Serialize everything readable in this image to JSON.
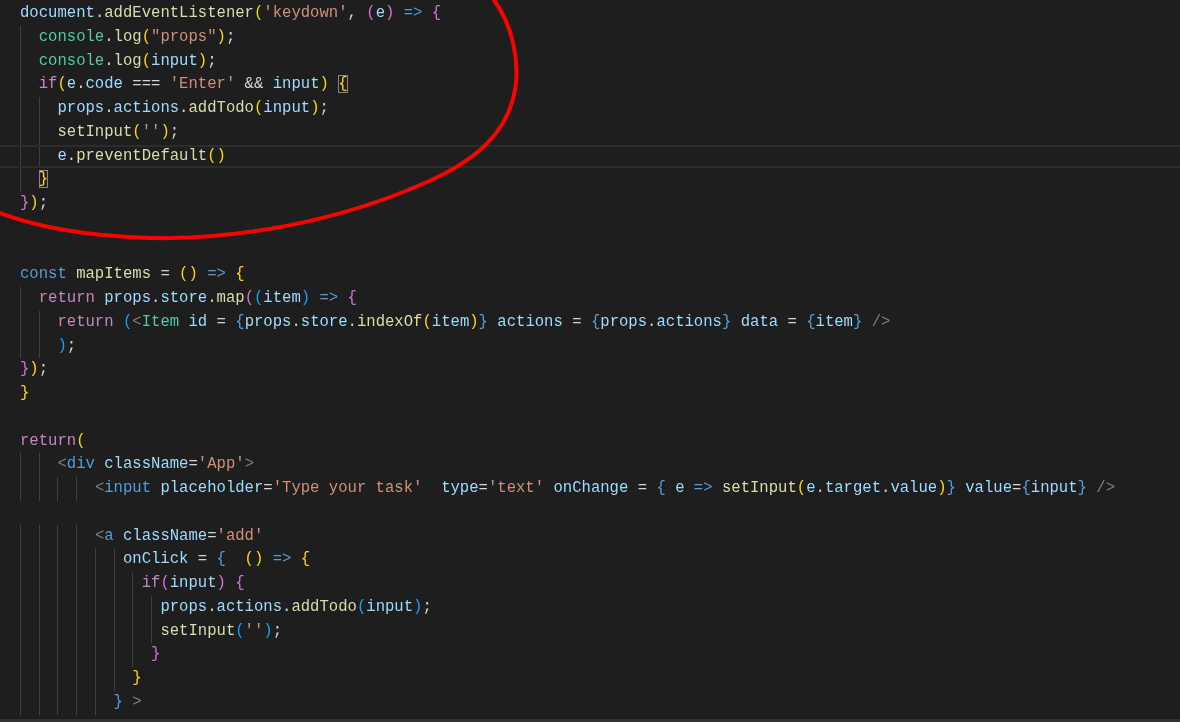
{
  "editor": {
    "lines": [
      {
        "current": false,
        "tokens": [
          {
            "text": "document",
            "kind": "var"
          },
          {
            "text": ".",
            "kind": "punct"
          },
          {
            "text": "addEventListener",
            "kind": "func"
          },
          {
            "text": "(",
            "kind": "bracket1"
          },
          {
            "text": "'keydown'",
            "kind": "string"
          },
          {
            "text": ", ",
            "kind": "punct"
          },
          {
            "text": "(",
            "kind": "bracket2"
          },
          {
            "text": "e",
            "kind": "var"
          },
          {
            "text": ")",
            "kind": "bracket2"
          },
          {
            "text": " => ",
            "kind": "storage"
          },
          {
            "text": "{",
            "kind": "bracket2"
          }
        ]
      },
      {
        "current": false,
        "tokens": [
          {
            "text": "  console",
            "kind": "type"
          },
          {
            "text": ".",
            "kind": "punct"
          },
          {
            "text": "log",
            "kind": "func"
          },
          {
            "text": "(",
            "kind": "bracket1"
          },
          {
            "text": "\"props\"",
            "kind": "string"
          },
          {
            "text": ")",
            "kind": "bracket1"
          },
          {
            "text": ";",
            "kind": "punct"
          }
        ]
      },
      {
        "current": false,
        "tokens": [
          {
            "text": "  console",
            "kind": "type"
          },
          {
            "text": ".",
            "kind": "punct"
          },
          {
            "text": "log",
            "kind": "func"
          },
          {
            "text": "(",
            "kind": "bracket1"
          },
          {
            "text": "input",
            "kind": "var"
          },
          {
            "text": ")",
            "kind": "bracket1"
          },
          {
            "text": ";",
            "kind": "punct"
          }
        ]
      },
      {
        "current": false,
        "tokens": [
          {
            "text": "  if",
            "kind": "keyword"
          },
          {
            "text": "(",
            "kind": "bracket1"
          },
          {
            "text": "e",
            "kind": "var"
          },
          {
            "text": ".",
            "kind": "punct"
          },
          {
            "text": "code",
            "kind": "var"
          },
          {
            "text": " === ",
            "kind": "punct"
          },
          {
            "text": "'Enter'",
            "kind": "string"
          },
          {
            "text": " && ",
            "kind": "punct"
          },
          {
            "text": "input",
            "kind": "var"
          },
          {
            "text": ") ",
            "kind": "bracket1"
          },
          {
            "text": "{",
            "kind": "matched"
          }
        ]
      },
      {
        "current": false,
        "tokens": [
          {
            "text": "    props",
            "kind": "var"
          },
          {
            "text": ".",
            "kind": "punct"
          },
          {
            "text": "actions",
            "kind": "var"
          },
          {
            "text": ".",
            "kind": "punct"
          },
          {
            "text": "addTodo",
            "kind": "func"
          },
          {
            "text": "(",
            "kind": "bracket1"
          },
          {
            "text": "input",
            "kind": "var"
          },
          {
            "text": ")",
            "kind": "bracket1"
          },
          {
            "text": ";",
            "kind": "punct"
          }
        ]
      },
      {
        "current": false,
        "tokens": [
          {
            "text": "    setInput",
            "kind": "func"
          },
          {
            "text": "(",
            "kind": "bracket1"
          },
          {
            "text": "''",
            "kind": "string"
          },
          {
            "text": ")",
            "kind": "bracket1"
          },
          {
            "text": ";",
            "kind": "punct"
          }
        ]
      },
      {
        "current": true,
        "tokens": [
          {
            "text": "    e",
            "kind": "var"
          },
          {
            "text": ".",
            "kind": "punct"
          },
          {
            "text": "preventDefault",
            "kind": "func"
          },
          {
            "text": "()",
            "kind": "bracket1"
          }
        ]
      },
      {
        "current": false,
        "tokens": [
          {
            "text": "  }",
            "kind": "matched"
          }
        ]
      },
      {
        "current": false,
        "tokens": [
          {
            "text": "}",
            "kind": "bracket2"
          },
          {
            "text": ")",
            "kind": "bracket1"
          },
          {
            "text": ";",
            "kind": "punct"
          }
        ]
      },
      {
        "current": false
      },
      {
        "current": false
      },
      {
        "current": false,
        "tokens": [
          {
            "text": "const ",
            "kind": "storage"
          },
          {
            "text": "mapItems",
            "kind": "func"
          },
          {
            "text": " = ",
            "kind": "punct"
          },
          {
            "text": "() ",
            "kind": "bracket1"
          },
          {
            "text": "=> ",
            "kind": "storage"
          },
          {
            "text": "{",
            "kind": "bracket1"
          }
        ]
      },
      {
        "current": false,
        "tokens": [
          {
            "text": "  return ",
            "kind": "keyword"
          },
          {
            "text": "props",
            "kind": "var"
          },
          {
            "text": ".",
            "kind": "punct"
          },
          {
            "text": "store",
            "kind": "var"
          },
          {
            "text": ".",
            "kind": "punct"
          },
          {
            "text": "map",
            "kind": "func"
          },
          {
            "text": "(",
            "kind": "bracket2"
          },
          {
            "text": "(",
            "kind": "bracket3"
          },
          {
            "text": "item",
            "kind": "var"
          },
          {
            "text": ") ",
            "kind": "bracket3"
          },
          {
            "text": "=> ",
            "kind": "storage"
          },
          {
            "text": "{",
            "kind": "bracket2"
          }
        ]
      },
      {
        "current": false,
        "tokens": [
          {
            "text": "    return ",
            "kind": "keyword"
          },
          {
            "text": "(",
            "kind": "bracket3"
          },
          {
            "text": "<",
            "kind": "tag"
          },
          {
            "text": "Item ",
            "kind": "type"
          },
          {
            "text": "id",
            "kind": "attr"
          },
          {
            "text": " = ",
            "kind": "punct"
          },
          {
            "text": "{",
            "kind": "storage"
          },
          {
            "text": "props",
            "kind": "var"
          },
          {
            "text": ".",
            "kind": "punct"
          },
          {
            "text": "store",
            "kind": "var"
          },
          {
            "text": ".",
            "kind": "punct"
          },
          {
            "text": "indexOf",
            "kind": "func"
          },
          {
            "text": "(",
            "kind": "bracket1"
          },
          {
            "text": "item",
            "kind": "var"
          },
          {
            "text": ")",
            "kind": "bracket1"
          },
          {
            "text": "} ",
            "kind": "storage"
          },
          {
            "text": "actions",
            "kind": "attr"
          },
          {
            "text": " = ",
            "kind": "punct"
          },
          {
            "text": "{",
            "kind": "storage"
          },
          {
            "text": "props",
            "kind": "var"
          },
          {
            "text": ".",
            "kind": "punct"
          },
          {
            "text": "actions",
            "kind": "var"
          },
          {
            "text": "} ",
            "kind": "storage"
          },
          {
            "text": "data",
            "kind": "attr"
          },
          {
            "text": " = ",
            "kind": "punct"
          },
          {
            "text": "{",
            "kind": "storage"
          },
          {
            "text": "item",
            "kind": "var"
          },
          {
            "text": "} ",
            "kind": "storage"
          },
          {
            "text": "/>",
            "kind": "tag"
          }
        ]
      },
      {
        "current": false,
        "tokens": [
          {
            "text": "    )",
            "kind": "bracket3"
          },
          {
            "text": ";",
            "kind": "punct"
          }
        ]
      },
      {
        "current": false,
        "tokens": [
          {
            "text": "}",
            "kind": "bracket2"
          },
          {
            "text": ")",
            "kind": "bracket1"
          },
          {
            "text": ";",
            "kind": "punct"
          }
        ]
      },
      {
        "current": false,
        "tokens": [
          {
            "text": "}",
            "kind": "bracket1"
          }
        ]
      },
      {
        "current": false
      },
      {
        "current": false,
        "tokens": [
          {
            "text": "return",
            "kind": "keyword"
          },
          {
            "text": "(",
            "kind": "bracket1"
          }
        ]
      },
      {
        "current": false,
        "tokens": [
          {
            "text": "    <",
            "kind": "tag"
          },
          {
            "text": "div ",
            "kind": "storage"
          },
          {
            "text": "className",
            "kind": "attr"
          },
          {
            "text": "=",
            "kind": "punct"
          },
          {
            "text": "'App'",
            "kind": "string"
          },
          {
            "text": ">",
            "kind": "tag"
          }
        ]
      },
      {
        "current": false,
        "tokens": [
          {
            "text": "        <",
            "kind": "tag"
          },
          {
            "text": "input ",
            "kind": "storage"
          },
          {
            "text": "placeholder",
            "kind": "attr"
          },
          {
            "text": "=",
            "kind": "punct"
          },
          {
            "text": "'Type your task'  ",
            "kind": "string"
          },
          {
            "text": "type",
            "kind": "attr"
          },
          {
            "text": "=",
            "kind": "punct"
          },
          {
            "text": "'text' ",
            "kind": "string"
          },
          {
            "text": "onChange",
            "kind": "attr"
          },
          {
            "text": " = ",
            "kind": "punct"
          },
          {
            "text": "{ ",
            "kind": "storage"
          },
          {
            "text": "e ",
            "kind": "var"
          },
          {
            "text": "=> ",
            "kind": "storage"
          },
          {
            "text": "setInput",
            "kind": "func"
          },
          {
            "text": "(",
            "kind": "bracket1"
          },
          {
            "text": "e",
            "kind": "var"
          },
          {
            "text": ".",
            "kind": "punct"
          },
          {
            "text": "target",
            "kind": "var"
          },
          {
            "text": ".",
            "kind": "punct"
          },
          {
            "text": "value",
            "kind": "var"
          },
          {
            "text": ")",
            "kind": "bracket1"
          },
          {
            "text": "} ",
            "kind": "storage"
          },
          {
            "text": "value",
            "kind": "attr"
          },
          {
            "text": "=",
            "kind": "punct"
          },
          {
            "text": "{",
            "kind": "storage"
          },
          {
            "text": "input",
            "kind": "var"
          },
          {
            "text": "} ",
            "kind": "storage"
          },
          {
            "text": "/>",
            "kind": "tag"
          }
        ]
      },
      {
        "current": false
      },
      {
        "current": false,
        "tokens": [
          {
            "text": "        <",
            "kind": "tag"
          },
          {
            "text": "a ",
            "kind": "storage"
          },
          {
            "text": "className",
            "kind": "attr"
          },
          {
            "text": "=",
            "kind": "punct"
          },
          {
            "text": "'add'",
            "kind": "string"
          }
        ]
      },
      {
        "current": false,
        "tokens": [
          {
            "text": "           onClick",
            "kind": "attr"
          },
          {
            "text": " = ",
            "kind": "punct"
          },
          {
            "text": "{  ",
            "kind": "storage"
          },
          {
            "text": "() ",
            "kind": "bracket1"
          },
          {
            "text": "=> ",
            "kind": "storage"
          },
          {
            "text": "{",
            "kind": "bracket1"
          }
        ]
      },
      {
        "current": false,
        "tokens": [
          {
            "text": "             if",
            "kind": "keyword"
          },
          {
            "text": "(",
            "kind": "bracket2"
          },
          {
            "text": "input",
            "kind": "var"
          },
          {
            "text": ") ",
            "kind": "bracket2"
          },
          {
            "text": "{",
            "kind": "bracket2"
          }
        ]
      },
      {
        "current": false,
        "tokens": [
          {
            "text": "               props",
            "kind": "var"
          },
          {
            "text": ".",
            "kind": "punct"
          },
          {
            "text": "actions",
            "kind": "var"
          },
          {
            "text": ".",
            "kind": "punct"
          },
          {
            "text": "addTodo",
            "kind": "func"
          },
          {
            "text": "(",
            "kind": "bracket3"
          },
          {
            "text": "input",
            "kind": "var"
          },
          {
            "text": ")",
            "kind": "bracket3"
          },
          {
            "text": ";",
            "kind": "punct"
          }
        ]
      },
      {
        "current": false,
        "tokens": [
          {
            "text": "               setInput",
            "kind": "func"
          },
          {
            "text": "(",
            "kind": "bracket3"
          },
          {
            "text": "''",
            "kind": "string"
          },
          {
            "text": ")",
            "kind": "bracket3"
          },
          {
            "text": ";",
            "kind": "punct"
          }
        ]
      },
      {
        "current": false,
        "tokens": [
          {
            "text": "              }",
            "kind": "bracket2"
          }
        ]
      },
      {
        "current": false,
        "tokens": [
          {
            "text": "            }",
            "kind": "bracket1"
          }
        ]
      },
      {
        "current": false,
        "tokens": [
          {
            "text": "          } ",
            "kind": "storage"
          },
          {
            "text": ">",
            "kind": "tag"
          }
        ]
      }
    ]
  }
}
